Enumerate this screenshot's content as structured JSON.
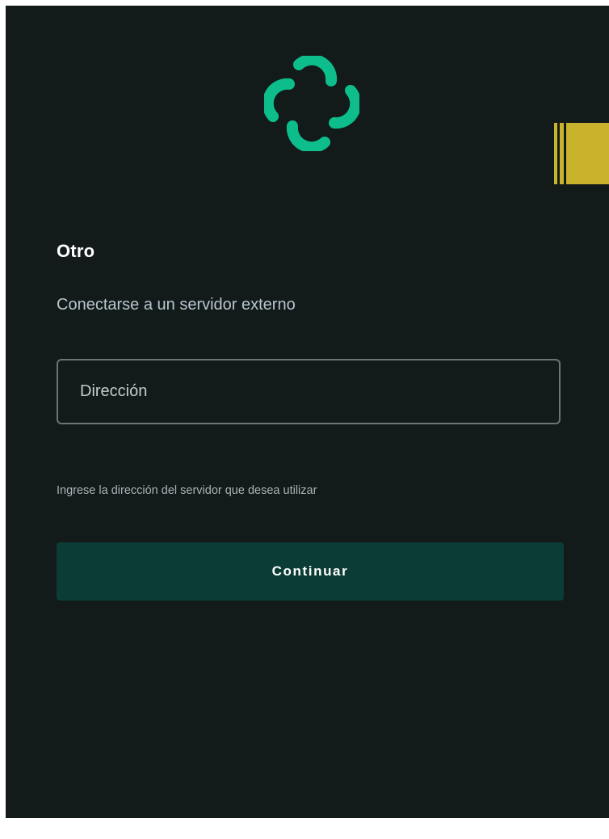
{
  "branding": {
    "logo_icon": "element-logo-icon",
    "accent_color": "#0dbd8b"
  },
  "header": {
    "title": "Otro",
    "subtitle": "Conectarse a un servidor externo"
  },
  "form": {
    "address": {
      "placeholder": "Dirección",
      "value": ""
    },
    "hint": "Ingrese la dirección del servidor que desea utilizar",
    "continue_label": "Continuar"
  },
  "colors": {
    "background": "#121a1a",
    "button_background": "#0b3d36",
    "side_marker": "#c9b22c"
  }
}
